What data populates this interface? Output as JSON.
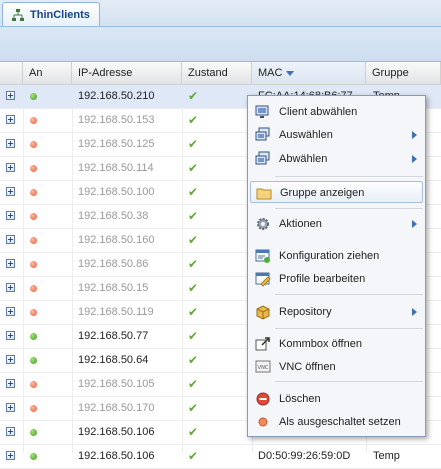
{
  "tab": {
    "label": "ThinClients"
  },
  "columns": {
    "an": "An",
    "ip": "IP-Adresse",
    "zustand": "Zustand",
    "mac": "MAC",
    "gruppe": "Gruppe"
  },
  "rows": [
    {
      "status": "on",
      "ip": "192.168.50.210",
      "zustand": "ok",
      "mac": "FC:AA:14:68:B6:77",
      "gruppe": "Temp"
    },
    {
      "status": "off",
      "ip": "192.168.50.153",
      "zustand": "ok",
      "mac": "",
      "gruppe": ""
    },
    {
      "status": "off",
      "ip": "192.168.50.125",
      "zustand": "ok",
      "mac": "",
      "gruppe": ""
    },
    {
      "status": "off",
      "ip": "192.168.50.114",
      "zustand": "ok",
      "mac": "",
      "gruppe": ""
    },
    {
      "status": "off",
      "ip": "192.168.50.100",
      "zustand": "ok",
      "mac": "",
      "gruppe": ""
    },
    {
      "status": "off",
      "ip": "192.168.50.38",
      "zustand": "ok",
      "mac": "",
      "gruppe": ""
    },
    {
      "status": "off",
      "ip": "192.168.50.160",
      "zustand": "ok",
      "mac": "",
      "gruppe": ""
    },
    {
      "status": "off",
      "ip": "192.168.50.86",
      "zustand": "ok",
      "mac": "",
      "gruppe": ""
    },
    {
      "status": "off",
      "ip": "192.168.50.15",
      "zustand": "ok",
      "mac": "",
      "gruppe": ""
    },
    {
      "status": "off",
      "ip": "192.168.50.119",
      "zustand": "ok",
      "mac": "",
      "gruppe": ""
    },
    {
      "status": "on",
      "ip": "192.168.50.77",
      "zustand": "ok",
      "mac": "",
      "gruppe": ""
    },
    {
      "status": "on",
      "ip": "192.168.50.64",
      "zustand": "ok",
      "mac": "",
      "gruppe": ""
    },
    {
      "status": "off",
      "ip": "192.168.50.105",
      "zustand": "ok",
      "mac": "",
      "gruppe": ""
    },
    {
      "status": "off",
      "ip": "192.168.50.170",
      "zustand": "ok",
      "mac": "",
      "gruppe": ""
    },
    {
      "status": "on",
      "ip": "192.168.50.106",
      "zustand": "ok",
      "mac": "",
      "gruppe": ""
    },
    {
      "status": "on",
      "ip": "192.168.50.106",
      "zustand": "ok",
      "mac": "D0:50:99:26:59:0D",
      "gruppe": "Temp"
    }
  ],
  "context_menu": {
    "items": [
      {
        "label": "Client abwählen",
        "icon": "monitor-icon",
        "submenu": false
      },
      {
        "label": "Auswählen",
        "icon": "monitors-icon",
        "submenu": true
      },
      {
        "label": "Abwählen",
        "icon": "monitors-icon",
        "submenu": true
      },
      {
        "label": "Gruppe anzeigen",
        "icon": "folder-icon",
        "submenu": false
      },
      {
        "label": "Aktionen",
        "icon": "gear-icon",
        "submenu": true
      },
      {
        "label": "Konfiguration ziehen",
        "icon": "config-pull-icon",
        "submenu": false
      },
      {
        "label": "Profile bearbeiten",
        "icon": "profile-edit-icon",
        "submenu": false
      },
      {
        "label": "Repository",
        "icon": "package-icon",
        "submenu": true
      },
      {
        "label": "Kommbox öffnen",
        "icon": "external-link-icon",
        "submenu": false
      },
      {
        "label": "VNC öffnen",
        "icon": "vnc-icon",
        "submenu": false
      },
      {
        "label": "Löschen",
        "icon": "delete-icon",
        "submenu": false
      },
      {
        "label": "Als ausgeschaltet setzen",
        "icon": "power-off-icon",
        "submenu": false
      }
    ],
    "vnc_icon_text": "VNC"
  },
  "colors": {
    "online": "#3f9a1e",
    "offline": "#e0603a",
    "check": "#5fa83a",
    "header_text": "#15428b",
    "selection": "#dfe8f6"
  }
}
